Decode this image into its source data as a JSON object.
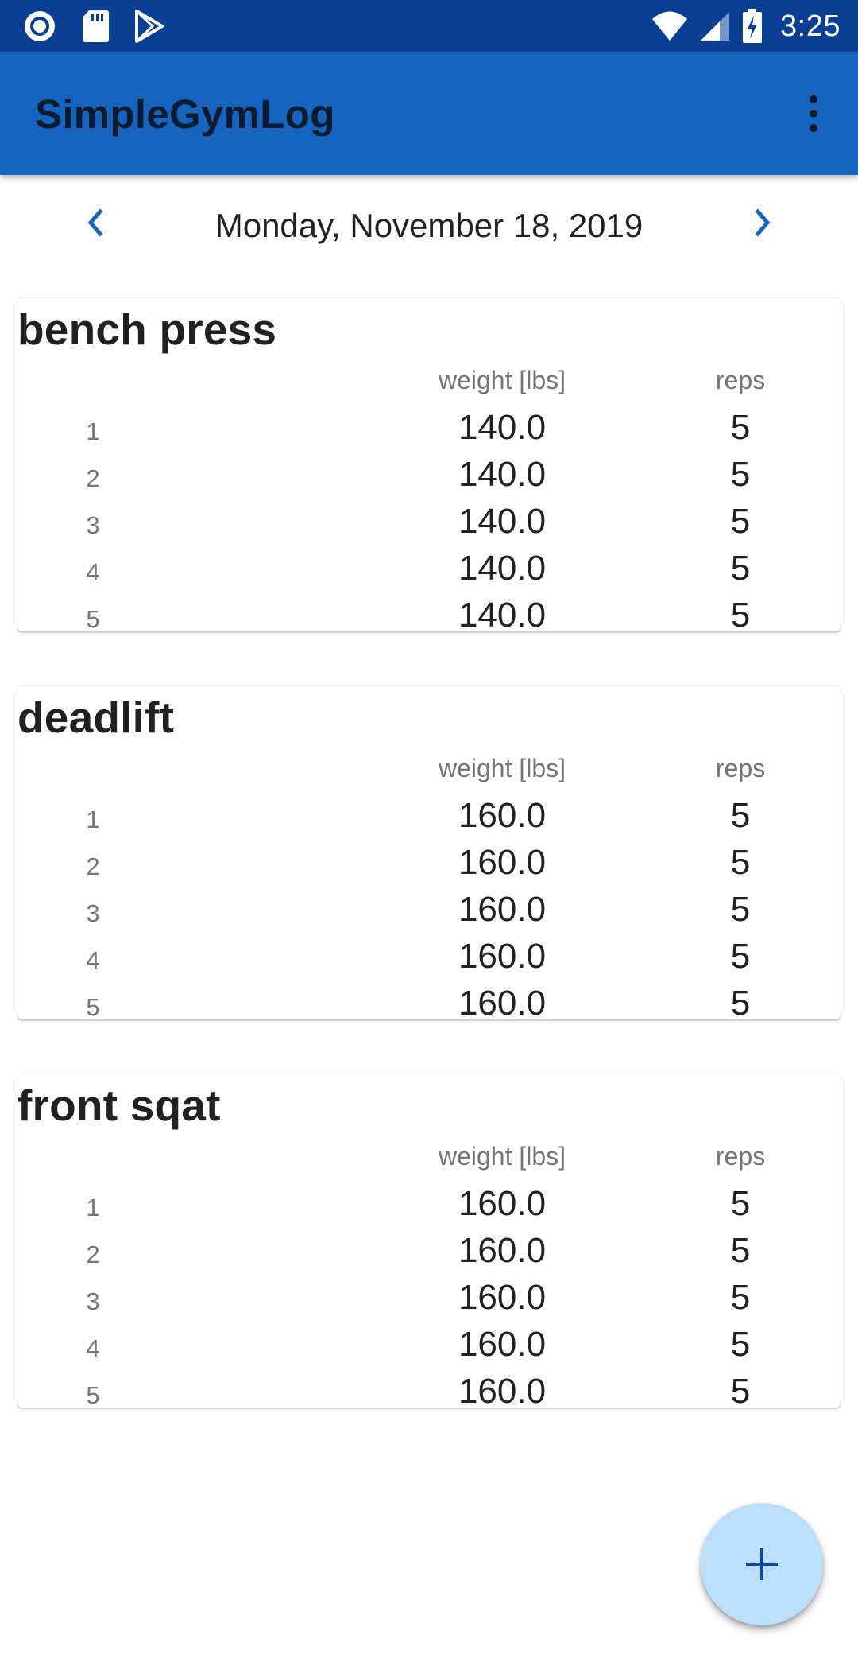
{
  "status_bar": {
    "time": "3:25",
    "left_icons": [
      "record-circle-icon",
      "sd-card-icon",
      "play-store-icon"
    ],
    "right_icons": [
      "wifi-icon",
      "cell-signal-icon",
      "battery-charging-icon"
    ]
  },
  "app_bar": {
    "title": "SimpleGymLog",
    "overflow_icon": "more-vert-icon"
  },
  "date_nav": {
    "date": "Monday, November 18, 2019",
    "prev_icon": "chevron-left-icon",
    "next_icon": "chevron-right-icon"
  },
  "column_headers": {
    "weight": "weight [lbs]",
    "reps": "reps"
  },
  "exercises": [
    {
      "name": "bench press",
      "sets": [
        {
          "num": "1",
          "weight": "140.0",
          "reps": "5"
        },
        {
          "num": "2",
          "weight": "140.0",
          "reps": "5"
        },
        {
          "num": "3",
          "weight": "140.0",
          "reps": "5"
        },
        {
          "num": "4",
          "weight": "140.0",
          "reps": "5"
        },
        {
          "num": "5",
          "weight": "140.0",
          "reps": "5"
        }
      ]
    },
    {
      "name": "deadlift",
      "sets": [
        {
          "num": "1",
          "weight": "160.0",
          "reps": "5"
        },
        {
          "num": "2",
          "weight": "160.0",
          "reps": "5"
        },
        {
          "num": "3",
          "weight": "160.0",
          "reps": "5"
        },
        {
          "num": "4",
          "weight": "160.0",
          "reps": "5"
        },
        {
          "num": "5",
          "weight": "160.0",
          "reps": "5"
        }
      ]
    },
    {
      "name": "front sqat",
      "sets": [
        {
          "num": "1",
          "weight": "160.0",
          "reps": "5"
        },
        {
          "num": "2",
          "weight": "160.0",
          "reps": "5"
        },
        {
          "num": "3",
          "weight": "160.0",
          "reps": "5"
        },
        {
          "num": "4",
          "weight": "160.0",
          "reps": "5"
        },
        {
          "num": "5",
          "weight": "160.0",
          "reps": "5"
        }
      ]
    }
  ],
  "fab": {
    "icon": "plus-icon"
  },
  "colors": {
    "status_bar": "#0b3f93",
    "app_bar": "#1565c0",
    "accent": "#1565c0",
    "fab_background": "#bbdefb",
    "fab_icon": "#0d47a1"
  }
}
